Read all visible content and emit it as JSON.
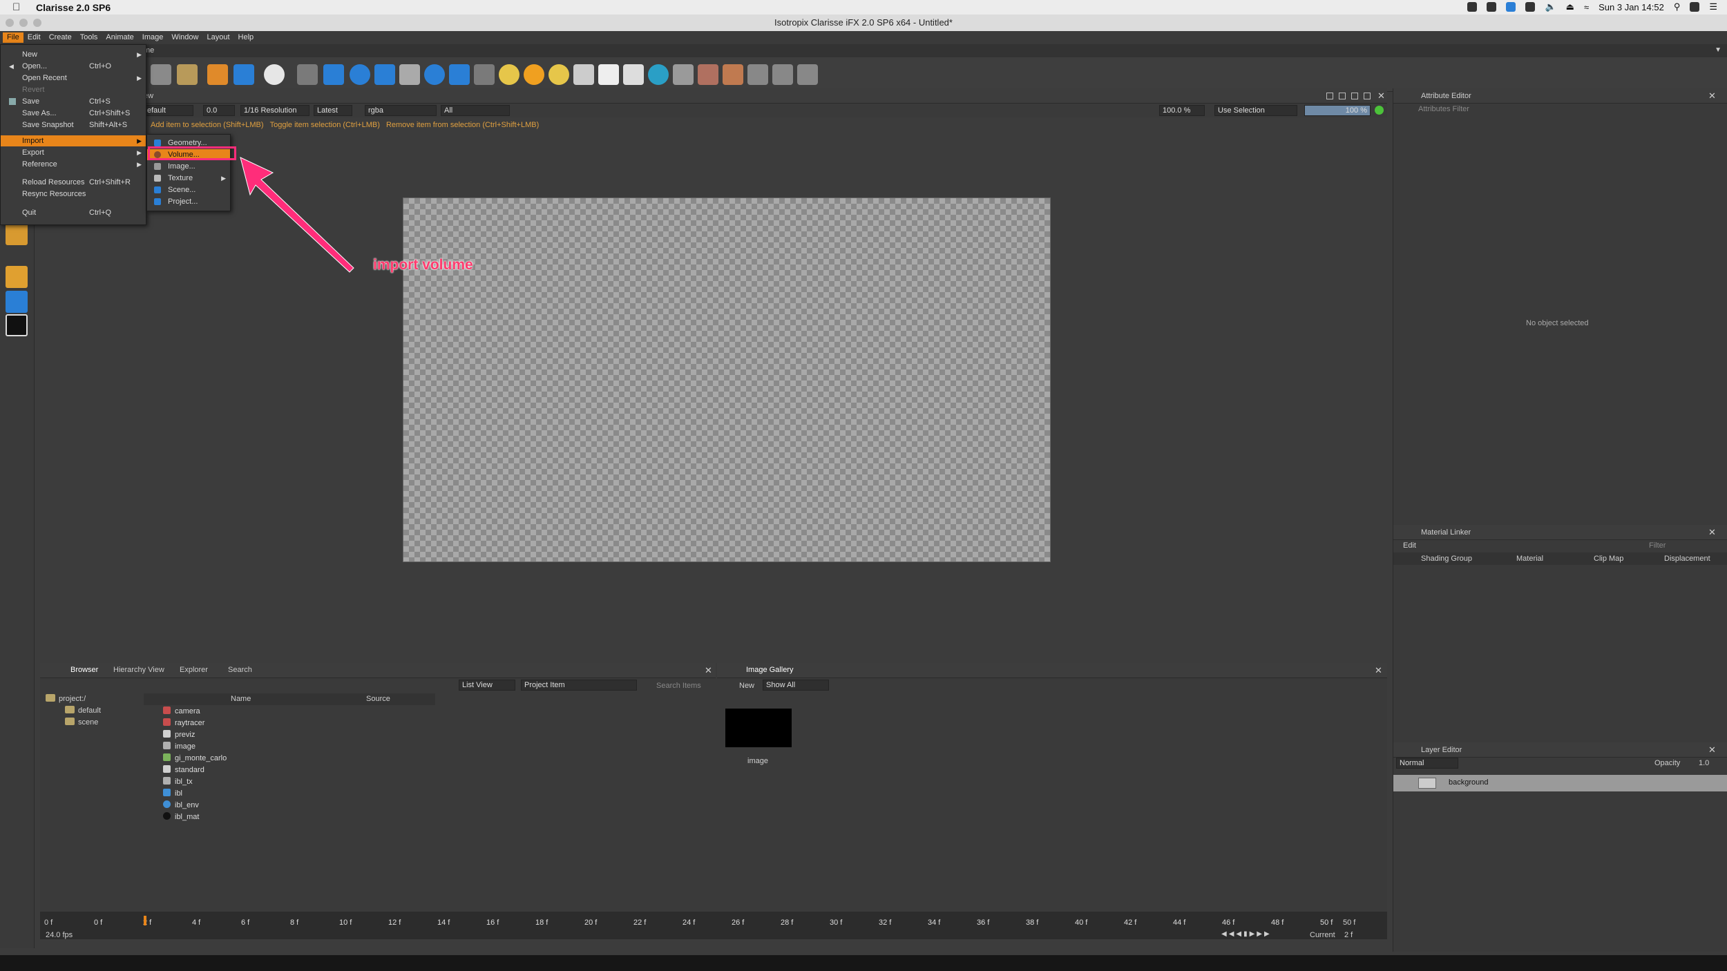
{
  "mac_menubar": {
    "app_name": "Clarisse 2.0 SP6",
    "datetime": "Sun 3 Jan  14:52"
  },
  "window_title": "Isotropix Clarisse iFX 2.0 SP6 x64  - Untitled*",
  "menubar": [
    "File",
    "Edit",
    "Create",
    "Tools",
    "Animate",
    "Image",
    "Window",
    "Layout",
    "Help"
  ],
  "file_menu": [
    {
      "label": "New",
      "shortcut": "",
      "submenu": true
    },
    {
      "label": "Open...",
      "shortcut": "Ctrl+O"
    },
    {
      "label": "Open Recent",
      "shortcut": "",
      "submenu": true
    },
    {
      "label": "Revert",
      "shortcut": "",
      "disabled": true
    },
    {
      "label": "Save",
      "shortcut": "Ctrl+S"
    },
    {
      "label": "Save As...",
      "shortcut": "Ctrl+Shift+S"
    },
    {
      "label": "Save Snapshot",
      "shortcut": "Shift+Alt+S"
    },
    {
      "label": "Import",
      "shortcut": "",
      "submenu": true,
      "highlighted": true
    },
    {
      "label": "Export",
      "shortcut": "",
      "submenu": true
    },
    {
      "label": "Reference",
      "shortcut": "",
      "submenu": true
    },
    {
      "label": "Reload Resources",
      "shortcut": "Ctrl+Shift+R"
    },
    {
      "label": "Resync Resources",
      "shortcut": ""
    },
    {
      "label": "Quit",
      "shortcut": "Ctrl+Q"
    }
  ],
  "import_submenu": [
    {
      "label": "Geometry...",
      "icon": "geometry-icon"
    },
    {
      "label": "Volume...",
      "icon": "volume-icon",
      "highlighted": true
    },
    {
      "label": "Image...",
      "icon": "image-icon"
    },
    {
      "label": "Texture",
      "icon": "texture-icon",
      "submenu": true
    },
    {
      "label": "Scene...",
      "icon": "scene-icon"
    },
    {
      "label": "Project...",
      "icon": "project-icon"
    }
  ],
  "annotation": "import volume",
  "viewport_controls": {
    "camera": "efault",
    "exposure": "0.0",
    "resolution": "1/16 Resolution",
    "version": "Latest",
    "channel": "rgba",
    "layer": "All",
    "zoom": "100.0 %",
    "selection_mode": "Use Selection",
    "progress": "100 %"
  },
  "hint_bar": [
    "Add item to selection (Shift+LMB)",
    "Toggle item selection (Ctrl+LMB)",
    "Remove item from selection (Ctrl+Shift+LMB)"
  ],
  "tab_row_label": "ew",
  "tab_row_label2": "me",
  "attribute_editor": {
    "title": "Attribute Editor",
    "filter_placeholder": "Attributes Filter",
    "empty_text": "No object selected"
  },
  "material_linker": {
    "title": "Material Linker",
    "edit_label": "Edit",
    "filter_placeholder": "Filter",
    "columns": [
      "Shading Group",
      "Material",
      "Clip Map",
      "Displacement"
    ]
  },
  "layer_editor": {
    "title": "Layer Editor",
    "blend_mode": "Normal",
    "opacity_label": "Opacity",
    "opacity_value": "1.0",
    "layers": [
      "background"
    ]
  },
  "browser": {
    "tabs": [
      "Browser",
      "Hierarchy View",
      "Explorer",
      "Search"
    ],
    "view_mode": "List View",
    "filter_type": "Project Item",
    "search_placeholder": "Search Items",
    "tree": [
      {
        "label": "project:/",
        "level": 0
      },
      {
        "label": "default",
        "level": 1
      },
      {
        "label": "scene",
        "level": 1
      }
    ],
    "columns": [
      "Name",
      "Source"
    ],
    "items": [
      {
        "name": "camera",
        "color": "#c84d4d"
      },
      {
        "name": "raytracer",
        "color": "#c84d4d"
      },
      {
        "name": "previz",
        "color": "#d0d0d0"
      },
      {
        "name": "image",
        "color": "#b0b0b0"
      },
      {
        "name": "gi_monte_carlo",
        "color": "#7bb35b"
      },
      {
        "name": "standard",
        "color": "#d0d0d0"
      },
      {
        "name": "ibl_tx",
        "color": "#b0b0b0"
      },
      {
        "name": "ibl",
        "color": "#3f8fd6"
      },
      {
        "name": "ibl_env",
        "color": "#3f8fd6"
      },
      {
        "name": "ibl_mat",
        "color": "#111111"
      }
    ]
  },
  "image_gallery": {
    "title": "Image Gallery",
    "new_label": "New",
    "filter": "Show All",
    "images": [
      "image"
    ]
  },
  "timeline": {
    "start": "0 f",
    "ticks": [
      "0 f",
      "2 f",
      "4 f",
      "6 f",
      "8 f",
      "10 f",
      "12 f",
      "14 f",
      "16 f",
      "18 f",
      "20 f",
      "22 f",
      "24 f",
      "26 f",
      "28 f",
      "30 f",
      "32 f",
      "34 f",
      "36 f",
      "38 f",
      "40 f",
      "42 f",
      "44 f",
      "46 f",
      "48 f",
      "50 f"
    ],
    "end": "50 f",
    "fps": "24.0 fps",
    "current_label": "Current",
    "current_value": "2 f"
  },
  "colors": {
    "accent": "#e8851a",
    "annotation": "#ff2d7a",
    "panel_bg": "#3a3a3a"
  }
}
